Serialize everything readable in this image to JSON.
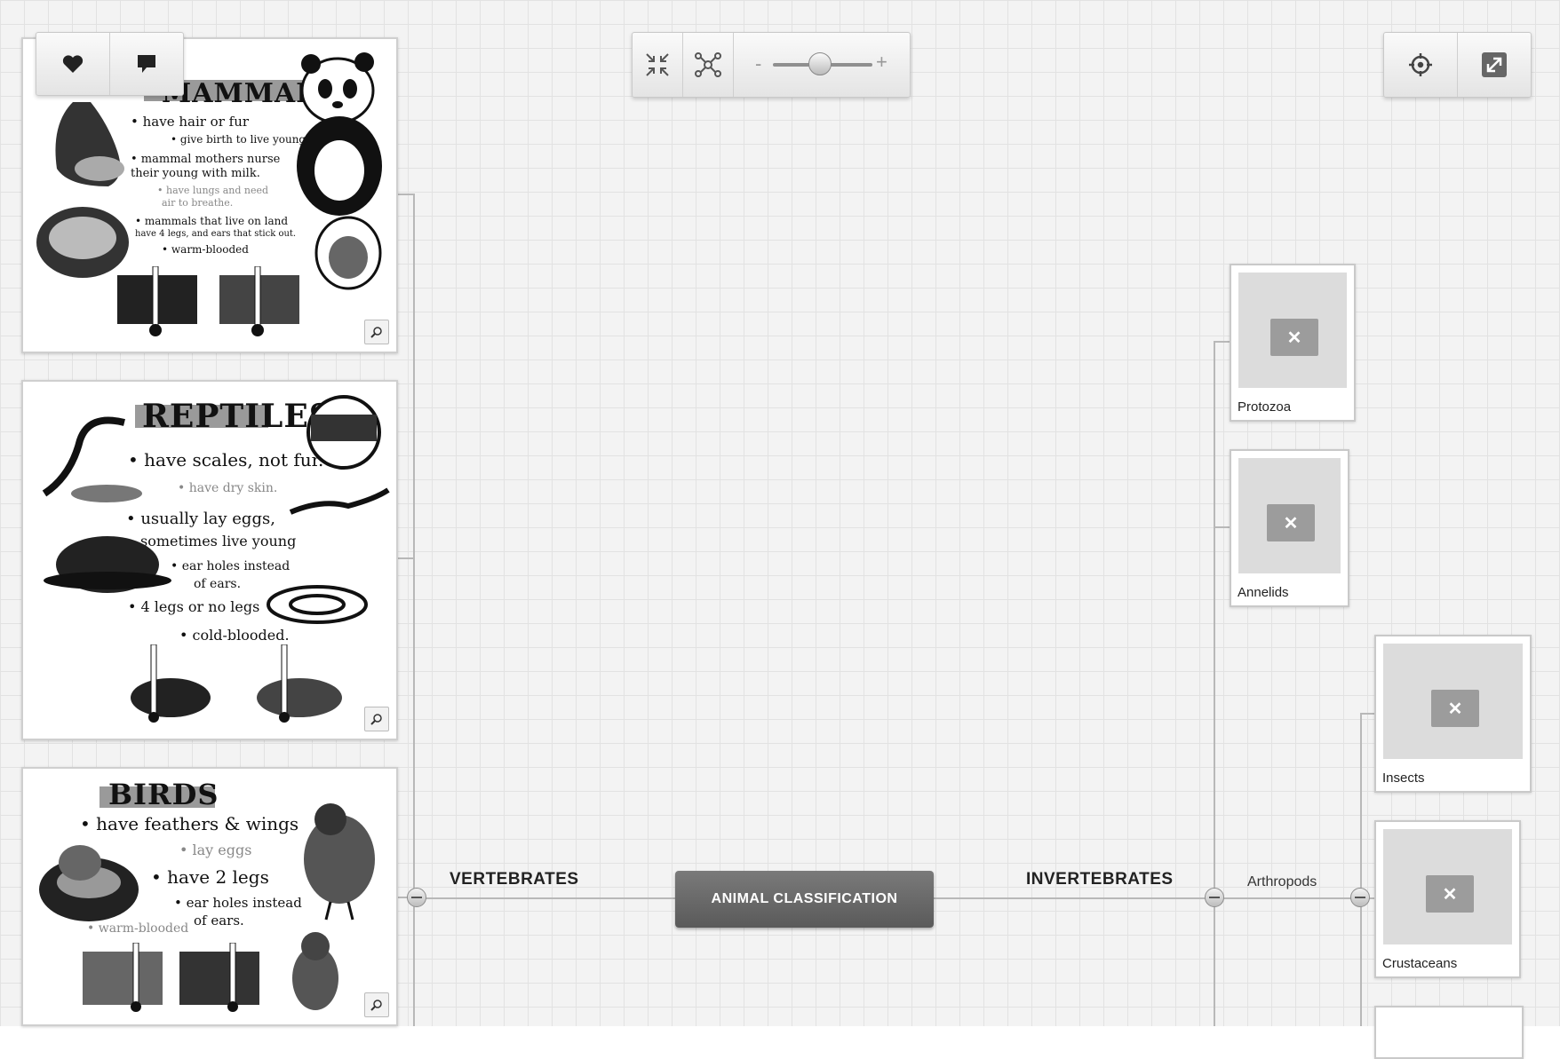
{
  "map": {
    "center": "ANIMAL CLASSIFICATION",
    "left_branch": "VERTEBRATES",
    "right_branch": "INVERTEBRATES",
    "sub_branch": "Arthropods",
    "nodes": {
      "protozoa": "Protozoa",
      "annelids": "Annelids",
      "insects": "Insects",
      "crustaceans": "Crustaceans"
    },
    "placeholder_symbol": "✕"
  },
  "cards": {
    "mammals": {
      "title": "MAMMALS",
      "lines": [
        "• have hair or fur",
        "• give birth to live young.",
        "• mammal mothers nurse",
        "their young with milk.",
        "• have lungs and need",
        "air to breathe.",
        "• mammals that live on land",
        "have 4 legs, and ears that stick out.",
        "• warm-blooded"
      ]
    },
    "reptiles": {
      "title": "REPTILES",
      "lines": [
        "• have scales, not fur.",
        "• have dry skin.",
        "• usually lay eggs,",
        "sometimes live young",
        "• ear holes instead",
        "of ears.",
        "• 4 legs or no legs",
        "• cold-blooded."
      ]
    },
    "birds": {
      "title": "BIRDS",
      "lines": [
        "• have feathers & wings",
        "• lay eggs",
        "• have 2 legs",
        "• ear holes instead",
        "of ears.",
        "• warm-blooded"
      ]
    }
  },
  "toolbar": {
    "zoom_minus": "-",
    "zoom_plus": "+"
  }
}
